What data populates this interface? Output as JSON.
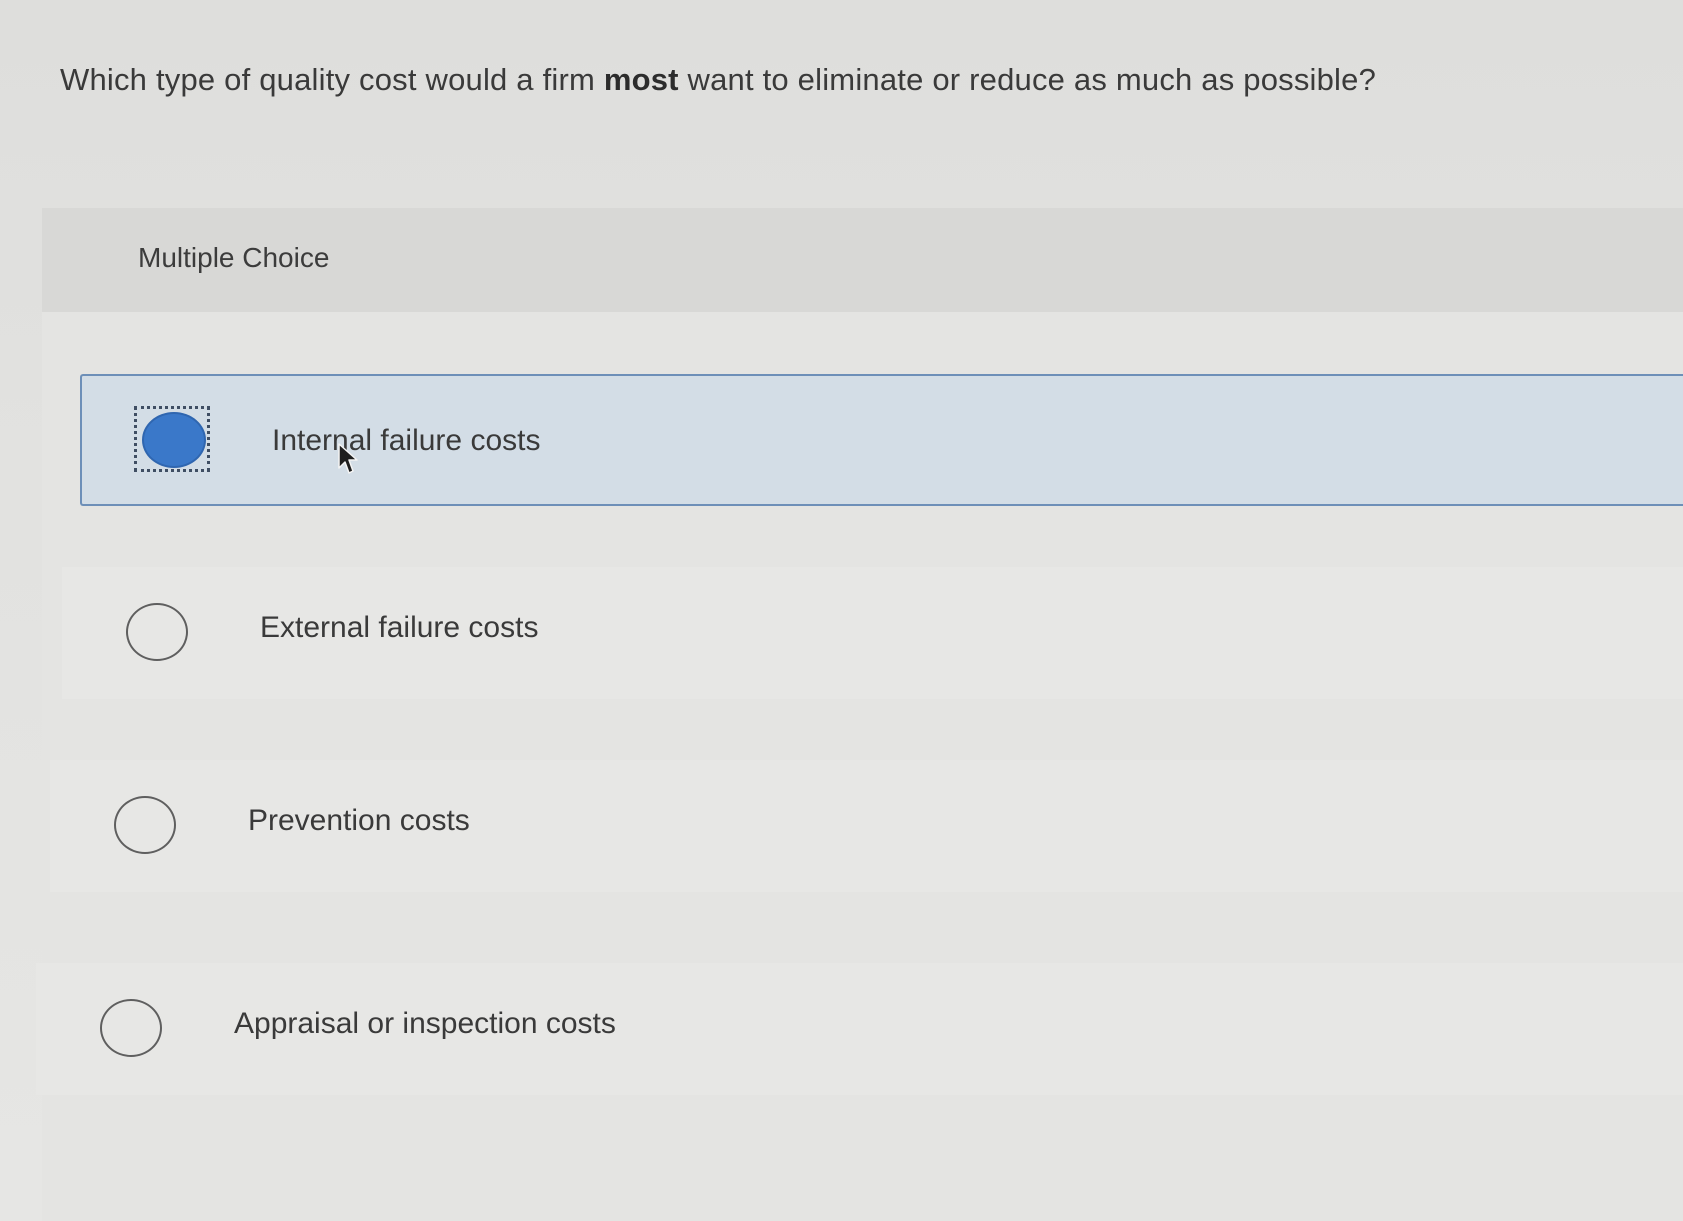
{
  "question": {
    "before": "Which type of quality cost would a firm ",
    "emphasis": "most",
    "after": " want to eliminate or reduce as much as possible?"
  },
  "multiple_choice": {
    "label": "Multiple Choice",
    "selected_index": 0,
    "options": [
      {
        "label": "Internal failure costs"
      },
      {
        "label": "External failure costs"
      },
      {
        "label": "Prevention costs"
      },
      {
        "label": "Appraisal or inspection costs"
      }
    ]
  },
  "colors": {
    "selected_background": "#d3dde6",
    "selected_border": "#6d8fb8",
    "radio_fill": "#3a78c9"
  },
  "icons": {
    "cursor": "mouse-pointer-icon",
    "selected_radio": "radio-selected-icon",
    "unselected_radio": "radio-unselected-icon"
  }
}
